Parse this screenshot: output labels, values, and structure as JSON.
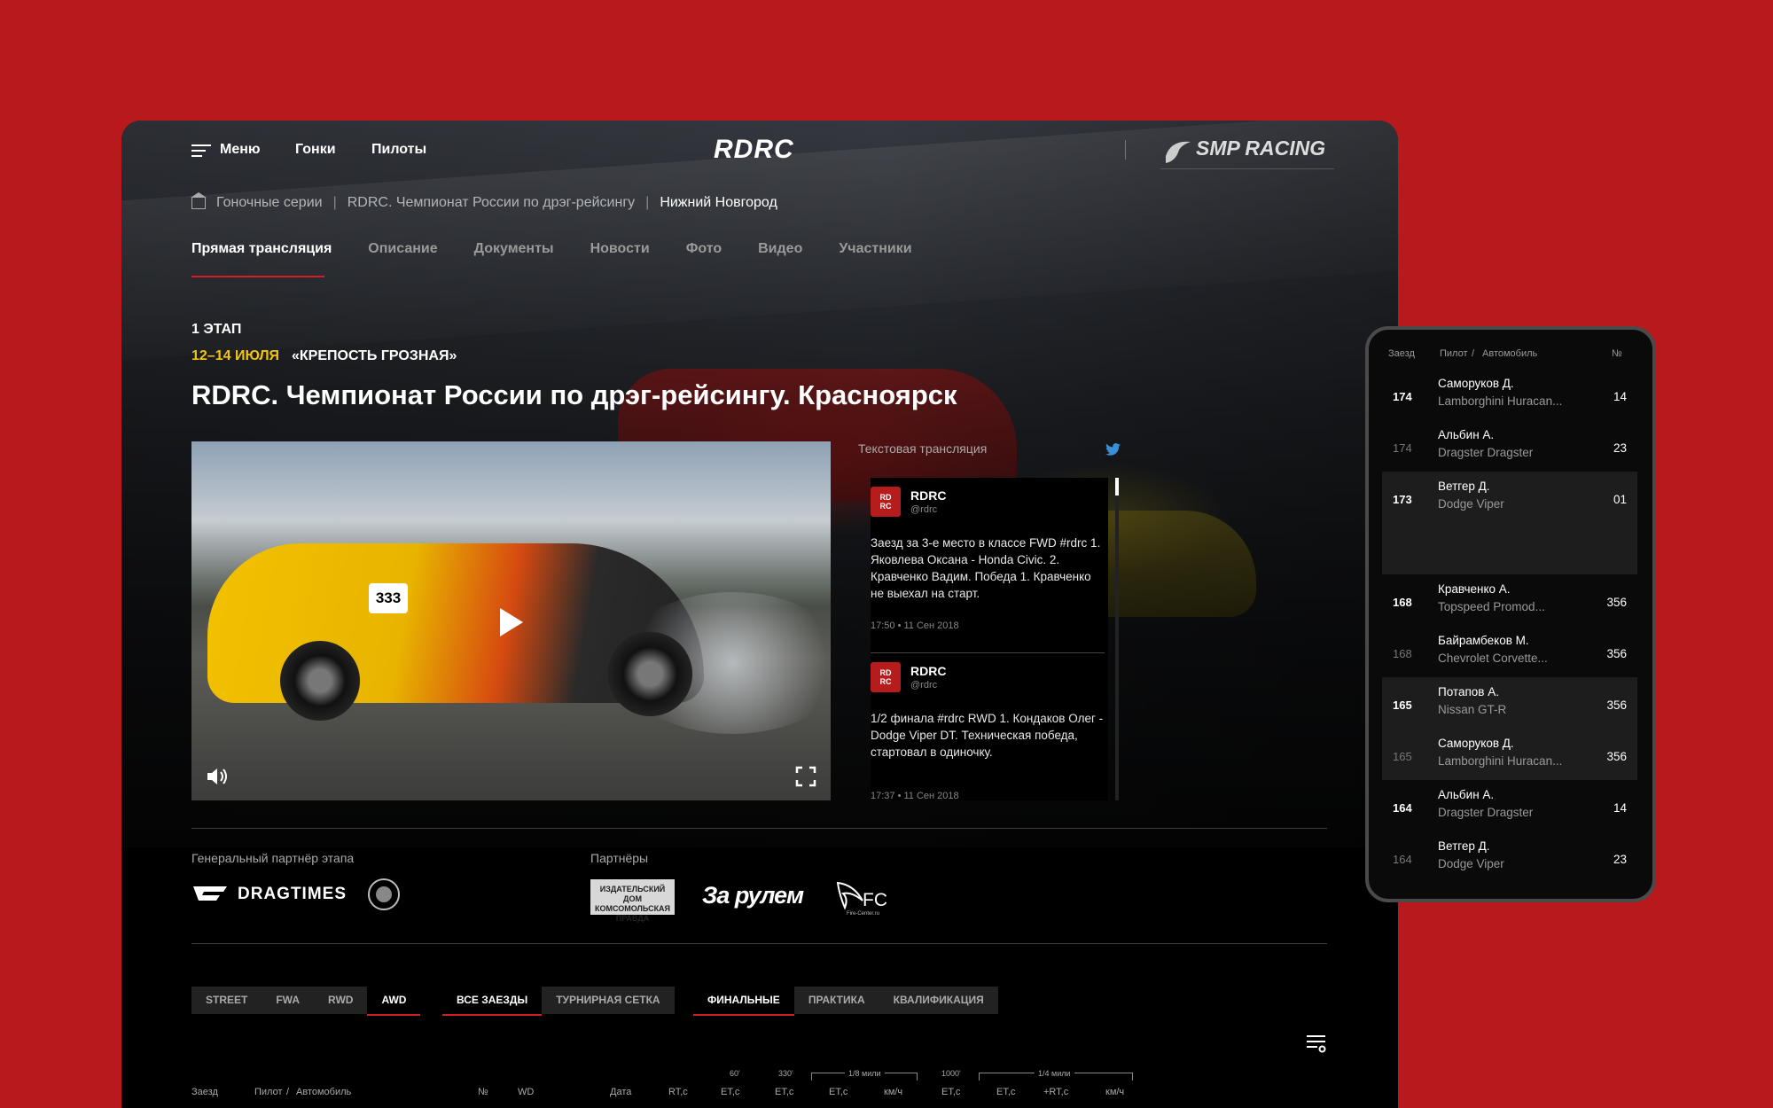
{
  "header": {
    "menu_label": "Меню",
    "nav_races": "Гонки",
    "nav_pilots": "Пилоты",
    "logo": "RDRC",
    "partner_logo": "SMP RACING"
  },
  "breadcrumb": {
    "item1": "Гоночные серии",
    "item2": "RDRC. Чемпионат России по дрэг-рейсингу",
    "current": "Нижний Новгород"
  },
  "tabs": [
    "Прямая трансляция",
    "Описание",
    "Документы",
    "Новости",
    "Фото",
    "Видео",
    "Участники"
  ],
  "event": {
    "stage": "1 ЭТАП",
    "dates": "12–14 ИЮЛЯ",
    "venue": "«КРЕПОСТЬ ГРОЗНАЯ»",
    "title": "RDRC. Чемпионат России по дрэг-рейсингу. Красноярск"
  },
  "video": {
    "car_number": "333"
  },
  "feed": {
    "label": "Текстовая трансляция",
    "tweets": [
      {
        "name": "RDRC",
        "handle": "@rdrc",
        "text": "Заезд за 3-е место в классе FWD #rdrc 1. Яковлева Оксана - Honda Civic. 2. Кравченко Вадим. Победа 1. Кравченко не выехал на старт.",
        "time": "17:50 • 11 Сен 2018"
      },
      {
        "name": "RDRC",
        "handle": "@rdrc",
        "text": "1/2 финала #rdrc RWD 1. Кондаков Олег - Dodge Viper DT. Техническая победа, стартовал в одиночку.",
        "time": "17:37 • 11 Сен 2018"
      }
    ]
  },
  "partners": {
    "general_label": "Генеральный партнёр этапа",
    "general_name": "DRAGTIMES",
    "label": "Партнёры",
    "kp": "ИЗДАТЕЛЬСКИЙ ДОМ КОМСОМОЛЬСКАЯ ПРАВДА",
    "zarulem": "За рулем",
    "fc": "FC",
    "fc_sub": "Fire-Center.ru"
  },
  "filters": {
    "classes": [
      "STREET",
      "FWA",
      "RWD",
      "AWD"
    ],
    "views": [
      "ВСЕ ЗАЕЗДЫ",
      "ТУРНИРНАЯ СЕТКА"
    ],
    "sessions": [
      "ФИНАЛЬНЫЕ",
      "ПРАКТИКА",
      "КВАЛИФИКАЦИЯ"
    ]
  },
  "table": {
    "headers": {
      "race": "Заезд",
      "pilot": "Пилот",
      "slash": "/",
      "car": "Автомобиль",
      "no": "№",
      "wd": "WD",
      "date": "Дата",
      "rt": "RT,c",
      "et60": "ET,c",
      "et330": "ET,c",
      "et18": "ET,c",
      "kmh1": "км/ч",
      "et1000": "ET,c",
      "et14": "ET,c",
      "plusrt": "+RT,c",
      "kmh2": "км/ч"
    },
    "groups": {
      "g60": "60'",
      "g330": "330'",
      "g18": "1/8 мили",
      "g1000": "1000'",
      "g14": "1/4 мили"
    }
  },
  "mobile": {
    "headers": {
      "race": "Заезд",
      "pilot": "Пилот",
      "slash": "/",
      "car": "Автомобиль",
      "no": "№"
    },
    "rows": [
      {
        "race": "174",
        "pilot": "Саморуков Д.",
        "car": "Lamborghini Huracan...",
        "no": "14"
      },
      {
        "race": "174",
        "pilot": "Альбин А.",
        "car": "Dragster Dragster",
        "no": "23"
      },
      {
        "race": "173",
        "pilot": "Ветгер Д.",
        "car": "Dodge Viper",
        "no": "01"
      },
      {
        "race": "168",
        "pilot": "Кравченко А.",
        "car": "Topspeed Promod...",
        "no": "356"
      },
      {
        "race": "168",
        "pilot": "Байрамбеков М.",
        "car": "Chevrolet Corvette...",
        "no": "356"
      },
      {
        "race": "165",
        "pilot": "Потапов А.",
        "car": "Nissan GT-R",
        "no": "356"
      },
      {
        "race": "165",
        "pilot": "Саморуков Д.",
        "car": "Lamborghini Huracan...",
        "no": "356"
      },
      {
        "race": "164",
        "pilot": "Альбин А.",
        "car": "Dragster Dragster",
        "no": "14"
      },
      {
        "race": "164",
        "pilot": "Ветгер Д.",
        "car": "Dodge Viper",
        "no": "23"
      }
    ]
  },
  "colors": {
    "background": "#b8191c",
    "accent": "#d02026",
    "date_yellow": "#f1c40f",
    "twitter": "#1da1f2"
  }
}
